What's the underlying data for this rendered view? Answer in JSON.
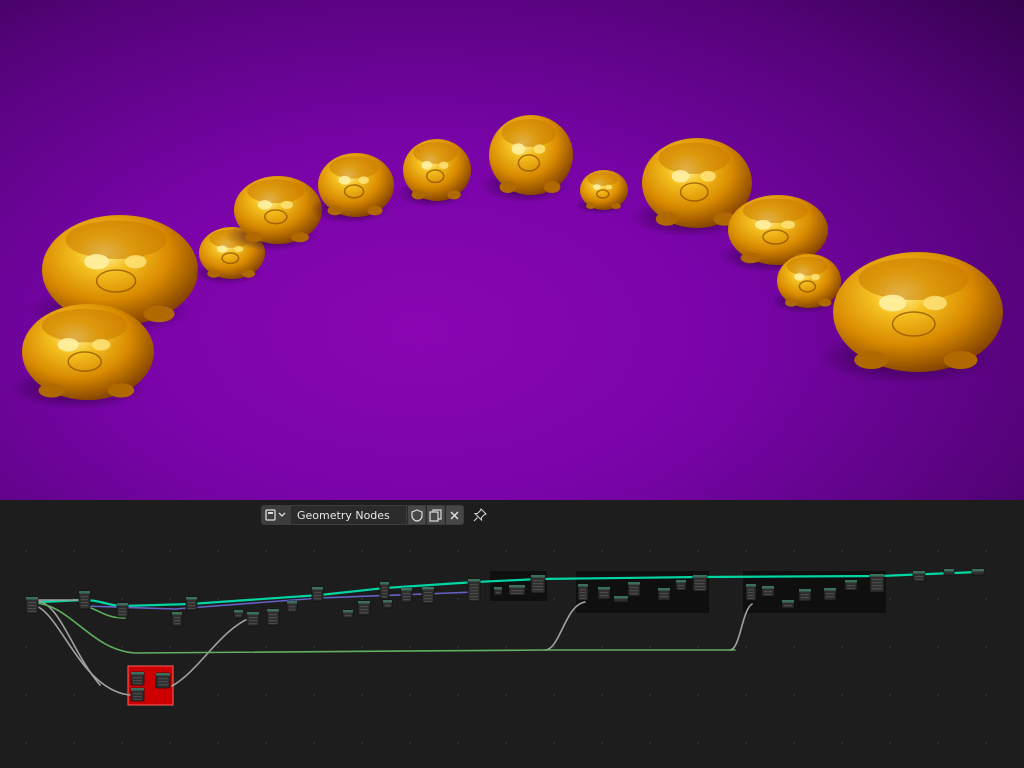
{
  "viewport": {
    "scene": "golden-creature-instances-on-purple-ground",
    "colors": {
      "background": "#7a05aa",
      "gold": "#e8a000",
      "gold_highlight": "#ffe070",
      "shadow": "#3a0050"
    }
  },
  "node_editor": {
    "header": {
      "editor_type_icon": "node-tree-icon",
      "node_group_name": "Geometry Nodes",
      "fake_user_icon": "shield-icon",
      "duplicate_icon": "duplicate-icon",
      "unlink_icon": "close-icon",
      "pin_icon": "pin-icon"
    },
    "colors": {
      "background": "#1d1d1d",
      "geometry_link": "#00d6a3",
      "float_link": "#a1a1a1",
      "vector_link": "#6363c7",
      "green_link": "#60b060",
      "frame": "#0f0f0f",
      "selected_frame": "#cc0000"
    }
  }
}
